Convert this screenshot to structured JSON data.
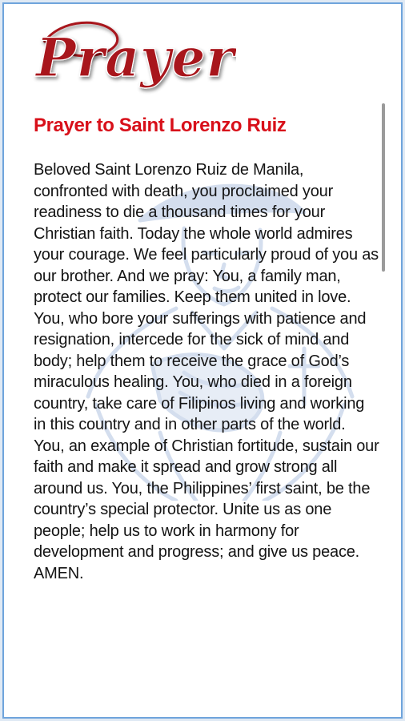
{
  "header": {
    "logo_text": "Prayer"
  },
  "prayer": {
    "title": "Prayer to Saint Lorenzo Ruiz",
    "body": "Beloved Saint Lorenzo Ruiz de Manila, confronted with death, you proclaimed your readiness to die a thousand times for your Christian faith. Today the whole world admires your courage. We feel particularly proud of you as our brother. And we pray: You, a family man, protect our families. Keep them united in love. You, who bore your sufferings with patience and resignation, intercede for the sick of mind and body; help them to receive the grace of God’s miraculous healing. You, who died in a foreign country, take care of Filipinos living and working in this country and in other parts of the world. You, an example of Christian fortitude, sustain our faith and make it spread and grow strong all around us. You, the Philippines’ first saint, be the country’s special protector. Unite us as one people; help us to work in harmony for development and progress; and give us peace. AMEN."
  },
  "colors": {
    "title_red": "#d8101a",
    "logo_red": "#a8141c",
    "frame_blue": "#6fa4dc",
    "watermark_blue": "#3f6fb6"
  }
}
